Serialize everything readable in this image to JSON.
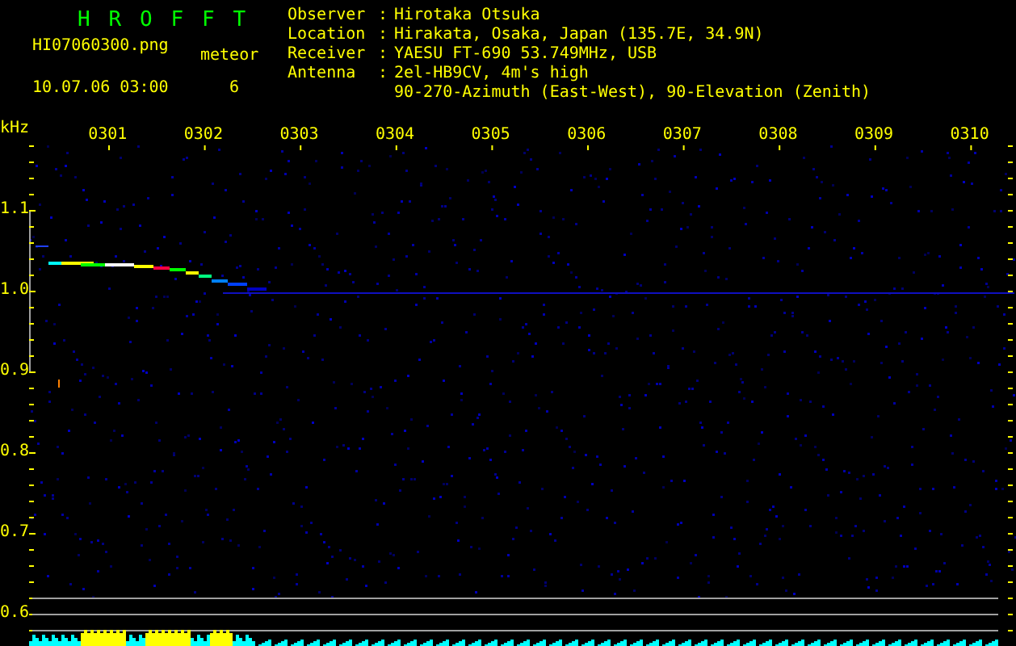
{
  "title": "H R O F F T",
  "file": {
    "name": "HI07060300.png",
    "datetime": "10.07.06 03:00"
  },
  "meteor": {
    "label": "meteor",
    "count": "6"
  },
  "station": [
    {
      "label": "Observer",
      "colon": ":",
      "values": [
        "Hirotaka Otsuka"
      ]
    },
    {
      "label": "Location",
      "colon": ":",
      "values": [
        "Hirakata, Osaka, Japan (135.7E, 34.9N)"
      ]
    },
    {
      "label": "Receiver",
      "colon": ":",
      "values": [
        "YAESU FT-690 53.749MHz, USB"
      ]
    },
    {
      "label": "Antenna",
      "colon": ":",
      "values": [
        "2el-HB9CV, 4m's high",
        "90-270-Azimuth (East-West), 90-Elevation (Zenith)"
      ]
    }
  ],
  "spectrogram": {
    "y_unit": "kHz",
    "x_labels": [
      "0301",
      "0302",
      "0303",
      "0304",
      "0305",
      "0306",
      "0307",
      "0308",
      "0309",
      "0310"
    ],
    "y_labels": [
      "1.1",
      "1.0",
      "0.9",
      "0.8",
      "0.7",
      "0.6"
    ]
  }
}
